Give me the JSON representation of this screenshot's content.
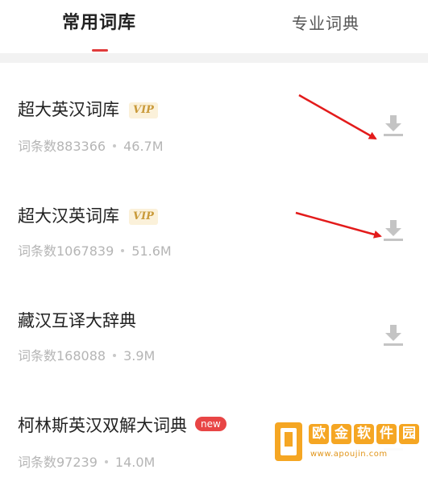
{
  "tabs": {
    "active_label": "常用词库",
    "inactive_label": "专业词典"
  },
  "dictionaries": [
    {
      "title": "超大英汉词库",
      "badge": "VIP",
      "entries": "词条数883366",
      "size": "46.7M"
    },
    {
      "title": "超大汉英词库",
      "badge": "VIP",
      "entries": "词条数1067839",
      "size": "51.6M"
    },
    {
      "title": "藏汉互译大辞典",
      "badge": "",
      "entries": "词条数168088",
      "size": "3.9M"
    },
    {
      "title": "柯林斯英汉双解大词典",
      "badge": "new",
      "entries": "词条数97239",
      "size": "14.0M"
    }
  ],
  "icons": {
    "download": "download-icon",
    "annotation": "red-arrow-annotation"
  },
  "colors": {
    "accent": "#e03b3b",
    "vip_text": "#c99a3a",
    "vip_bg": "#fbf1da",
    "new_badge": "#e84545",
    "meta_text": "#b5b5b5",
    "download_icon": "#c4c4c4",
    "watermark": "#f5a623"
  },
  "watermark": {
    "chars": [
      "欧",
      "金",
      "软",
      "件",
      "园"
    ],
    "url": "www.apoujin.com"
  }
}
